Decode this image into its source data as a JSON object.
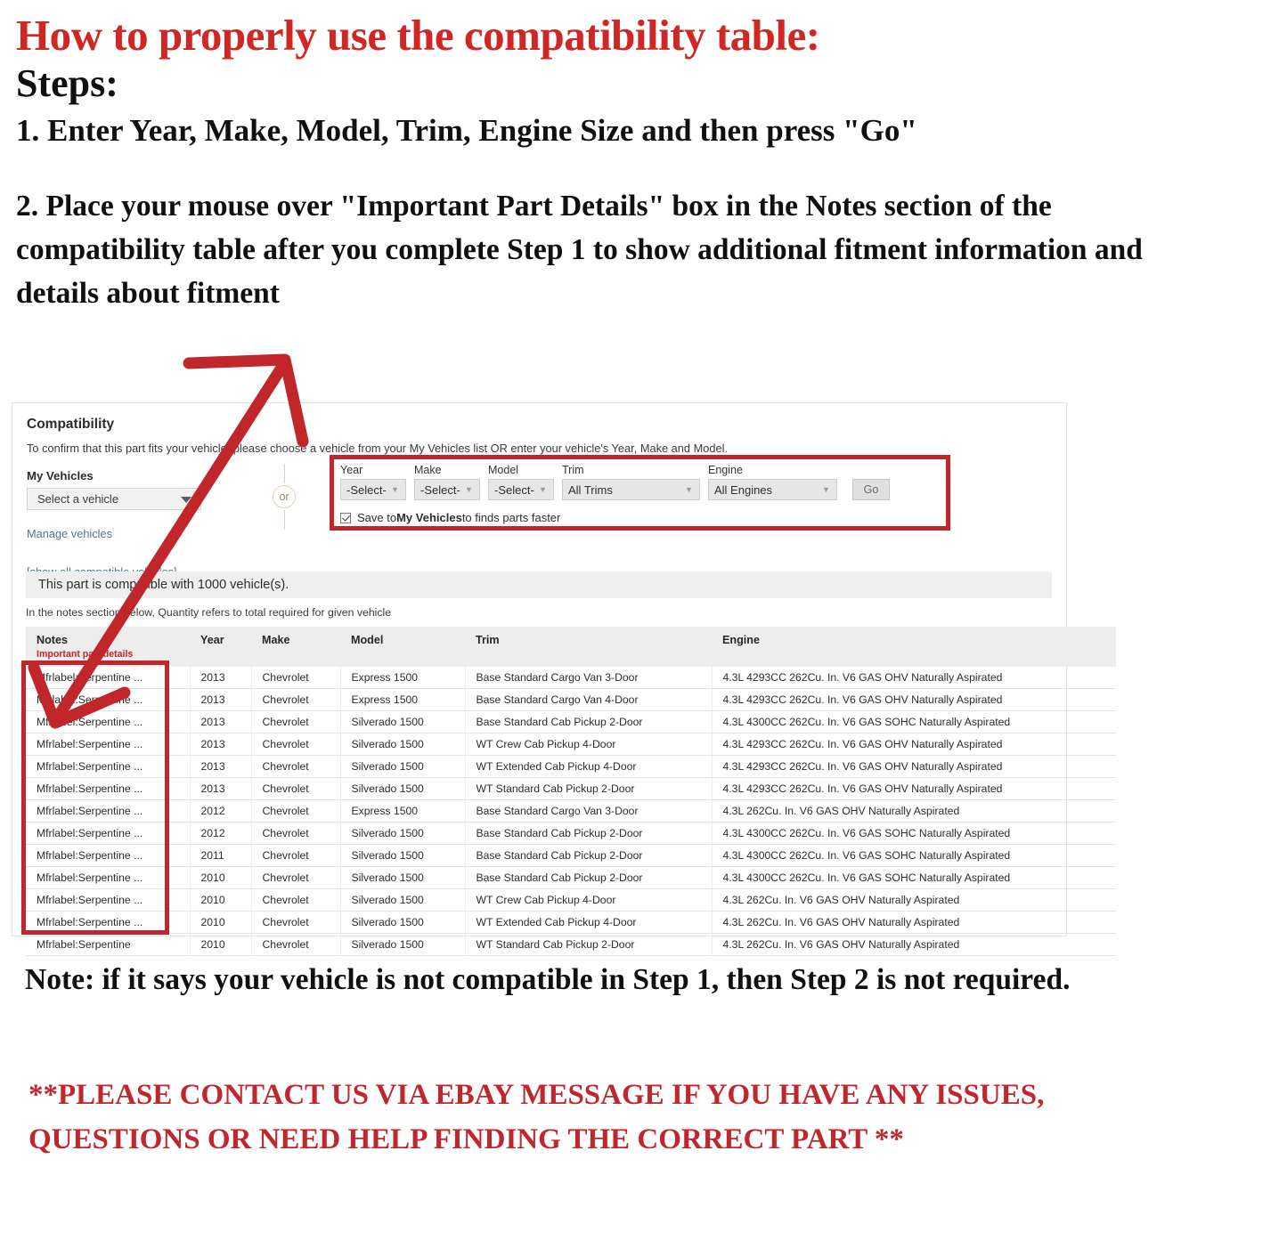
{
  "instructions": {
    "title": "How to properly use the compatibility table:",
    "steps_label": "Steps:",
    "step1": "1. Enter Year, Make, Model, Trim, Engine Size and then press \"Go\"",
    "step2": "2. Place your mouse over \"Important Part Details\" box in the Notes section of the compatibility table after you complete Step 1 to show additional fitment information and details about fitment",
    "note": "Note: if it says your vehicle is not compatible in Step 1, then Step 2 is not required.",
    "contact": "**PLEASE CONTACT US VIA EBAY MESSAGE IF YOU HAVE ANY ISSUES, QUESTIONS OR NEED HELP FINDING THE CORRECT PART **"
  },
  "colors": {
    "heading_red": "#d02724",
    "highlight_red": "#c1262a",
    "link_blue": "#4e7b8c",
    "notes_red": "#c0272d"
  },
  "panel": {
    "title": "Compatibility",
    "subtitle": "To confirm that this part fits your vehicle, please choose a vehicle from your My Vehicles list OR enter your vehicle's Year, Make and Model.",
    "my_vehicles_label": "My Vehicles",
    "vehicle_select_value": "Select a vehicle",
    "manage_vehicles_link": "Manage vehicles",
    "show_all_link": "[show all compatible vehicles]",
    "or_divider": "or",
    "compat_banner": "This part is compatible with 1000 vehicle(s).",
    "qty_note": "In the notes section below, Quantity refers to total required for given vehicle"
  },
  "form": {
    "fields": [
      {
        "label": "Year",
        "value": "-Select-",
        "size": "sm"
      },
      {
        "label": "Make",
        "value": "-Select-",
        "size": "sm"
      },
      {
        "label": "Model",
        "value": "-Select-",
        "size": "sm"
      },
      {
        "label": "Trim",
        "value": "All Trims",
        "size": "md"
      },
      {
        "label": "Engine",
        "value": "All Engines",
        "size": "lg"
      }
    ],
    "go_button": "Go",
    "save_checkbox": {
      "checked": true,
      "text_before": "Save to ",
      "text_bold": "My Vehicles",
      "text_after": " to finds parts faster"
    }
  },
  "table": {
    "headers": {
      "notes": "Notes",
      "notes_sub": "Important part details",
      "year": "Year",
      "make": "Make",
      "model": "Model",
      "trim": "Trim",
      "engine": "Engine"
    },
    "rows": [
      {
        "notes": "Mfrlabel:Serpentine ...",
        "year": "2013",
        "make": "Chevrolet",
        "model": "Express 1500",
        "trim": "Base Standard Cargo Van 3-Door",
        "engine": "4.3L 4293CC 262Cu. In. V6 GAS OHV Naturally Aspirated"
      },
      {
        "notes": "Mfrlabel:Serpentine ...",
        "year": "2013",
        "make": "Chevrolet",
        "model": "Express 1500",
        "trim": "Base Standard Cargo Van 4-Door",
        "engine": "4.3L 4293CC 262Cu. In. V6 GAS OHV Naturally Aspirated"
      },
      {
        "notes": "Mfrlabel:Serpentine ...",
        "year": "2013",
        "make": "Chevrolet",
        "model": "Silverado 1500",
        "trim": "Base Standard Cab Pickup 2-Door",
        "engine": "4.3L 4300CC 262Cu. In. V6 GAS SOHC Naturally Aspirated"
      },
      {
        "notes": "Mfrlabel:Serpentine ...",
        "year": "2013",
        "make": "Chevrolet",
        "model": "Silverado 1500",
        "trim": "WT Crew Cab Pickup 4-Door",
        "engine": "4.3L 4293CC 262Cu. In. V6 GAS OHV Naturally Aspirated"
      },
      {
        "notes": "Mfrlabel:Serpentine ...",
        "year": "2013",
        "make": "Chevrolet",
        "model": "Silverado 1500",
        "trim": "WT Extended Cab Pickup 4-Door",
        "engine": "4.3L 4293CC 262Cu. In. V6 GAS OHV Naturally Aspirated"
      },
      {
        "notes": "Mfrlabel:Serpentine ...",
        "year": "2013",
        "make": "Chevrolet",
        "model": "Silverado 1500",
        "trim": "WT Standard Cab Pickup 2-Door",
        "engine": "4.3L 4293CC 262Cu. In. V6 GAS OHV Naturally Aspirated"
      },
      {
        "notes": "Mfrlabel:Serpentine ...",
        "year": "2012",
        "make": "Chevrolet",
        "model": "Express 1500",
        "trim": "Base Standard Cargo Van 3-Door",
        "engine": "4.3L 262Cu. In. V6 GAS OHV Naturally Aspirated"
      },
      {
        "notes": "Mfrlabel:Serpentine ...",
        "year": "2012",
        "make": "Chevrolet",
        "model": "Silverado 1500",
        "trim": "Base Standard Cab Pickup 2-Door",
        "engine": "4.3L 4300CC 262Cu. In. V6 GAS SOHC Naturally Aspirated"
      },
      {
        "notes": "Mfrlabel:Serpentine ...",
        "year": "2011",
        "make": "Chevrolet",
        "model": "Silverado 1500",
        "trim": "Base Standard Cab Pickup 2-Door",
        "engine": "4.3L 4300CC 262Cu. In. V6 GAS SOHC Naturally Aspirated"
      },
      {
        "notes": "Mfrlabel:Serpentine ...",
        "year": "2010",
        "make": "Chevrolet",
        "model": "Silverado 1500",
        "trim": "Base Standard Cab Pickup 2-Door",
        "engine": "4.3L 4300CC 262Cu. In. V6 GAS SOHC Naturally Aspirated"
      },
      {
        "notes": "Mfrlabel:Serpentine ...",
        "year": "2010",
        "make": "Chevrolet",
        "model": "Silverado 1500",
        "trim": "WT Crew Cab Pickup 4-Door",
        "engine": "4.3L 262Cu. In. V6 GAS OHV Naturally Aspirated"
      },
      {
        "notes": "Mfrlabel:Serpentine ...",
        "year": "2010",
        "make": "Chevrolet",
        "model": "Silverado 1500",
        "trim": "WT Extended Cab Pickup 4-Door",
        "engine": "4.3L 262Cu. In. V6 GAS OHV Naturally Aspirated"
      },
      {
        "notes": "Mfrlabel:Serpentine",
        "year": "2010",
        "make": "Chevrolet",
        "model": "Silverado 1500",
        "trim": "WT Standard Cab Pickup 2-Door",
        "engine": "4.3L 262Cu. In. V6 GAS OHV Naturally Aspirated"
      }
    ]
  }
}
